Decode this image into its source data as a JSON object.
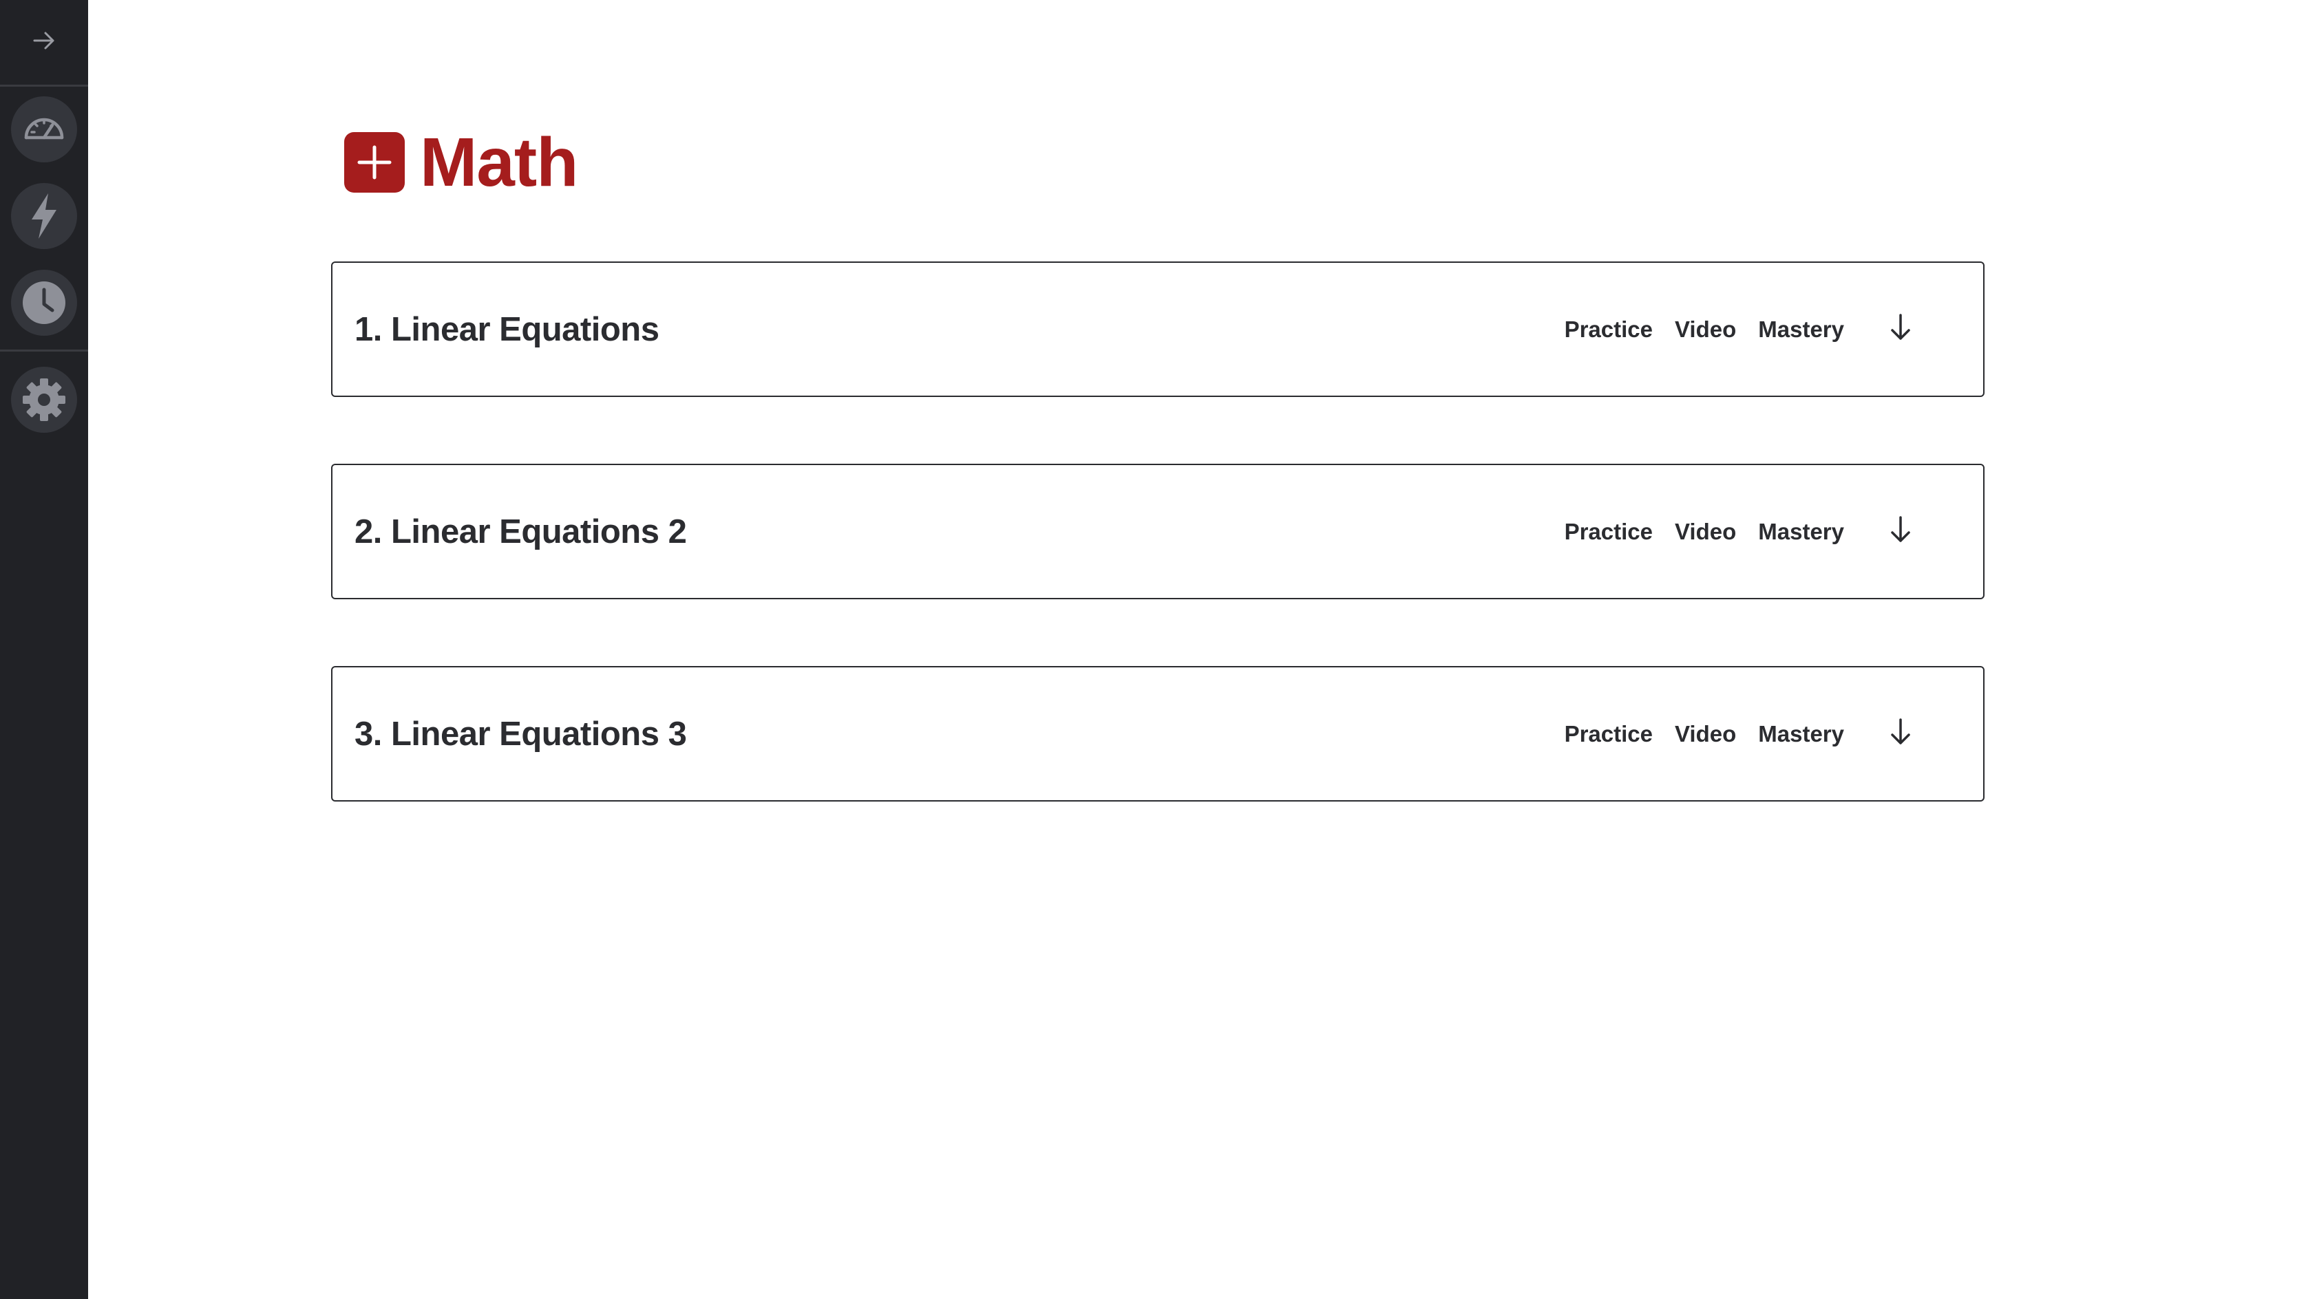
{
  "sidebar": {
    "collapse_icon": "arrow-right-icon",
    "items": [
      {
        "icon": "speedometer-icon"
      },
      {
        "icon": "lightning-icon"
      },
      {
        "icon": "clock-icon"
      },
      {
        "icon": "gear-icon"
      }
    ]
  },
  "page": {
    "title": "Math",
    "title_icon": "plus-square-icon",
    "accent_color": "#a51d1d"
  },
  "lessons": [
    {
      "title": "1. Linear Equations",
      "practice": "Practice",
      "video": "Video",
      "mastery": "Mastery",
      "expand_icon": "arrow-down-icon"
    },
    {
      "title": "2. Linear Equations 2",
      "practice": "Practice",
      "video": "Video",
      "mastery": "Mastery",
      "expand_icon": "arrow-down-icon"
    },
    {
      "title": "3. Linear Equations 3",
      "practice": "Practice",
      "video": "Video",
      "mastery": "Mastery",
      "expand_icon": "arrow-down-icon"
    }
  ]
}
